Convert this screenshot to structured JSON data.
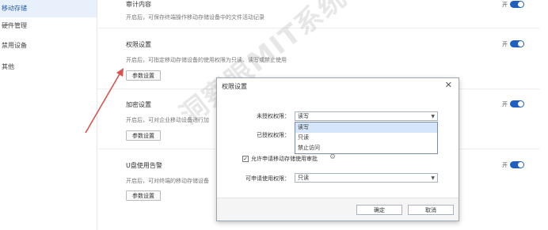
{
  "sidebar": {
    "items": [
      {
        "label": "移动存储",
        "active": true
      },
      {
        "label": "硬件管理",
        "active": false
      },
      {
        "label": "禁用设备",
        "active": false
      },
      {
        "label": "其他",
        "active": false
      }
    ]
  },
  "sections": [
    {
      "title": "审计内容",
      "desc": "开启后，可保存终端操作移动存储设备中的文件活动记录",
      "toggle_label": "开"
    },
    {
      "title": "权限设置",
      "desc": "开启后，可指定移动存储设备的使用权限为只读、读写或禁止使用",
      "toggle_label": "开",
      "button": "参数设置"
    },
    {
      "title": "加密设置",
      "desc": "开启后，可对企业移动设备进行加",
      "toggle_label": "开",
      "button": "参数设置"
    },
    {
      "title": "U盘使用告警",
      "desc": "开启后，可对终端的移动存储设备",
      "toggle_label": "开",
      "button": "参数设置"
    }
  ],
  "watermark": "洞察眼MIT系统",
  "dialog": {
    "title": "权限设置",
    "close": "✕",
    "unauth_label": "未授权权限：",
    "unauth_value": "读写",
    "auth_label": "已授权权限：",
    "options": [
      "读写",
      "只读",
      "禁止访问"
    ],
    "selected_option": "读写",
    "checkbox_label": "允许申请移动存储使用审批",
    "checkbox_checked": true,
    "apply_label": "可申请使用权限：",
    "apply_value": "只读",
    "ok": "确定",
    "cancel": "取消"
  },
  "colors": {
    "accent": "#1f5fbf",
    "arrow": "#d9534f"
  }
}
